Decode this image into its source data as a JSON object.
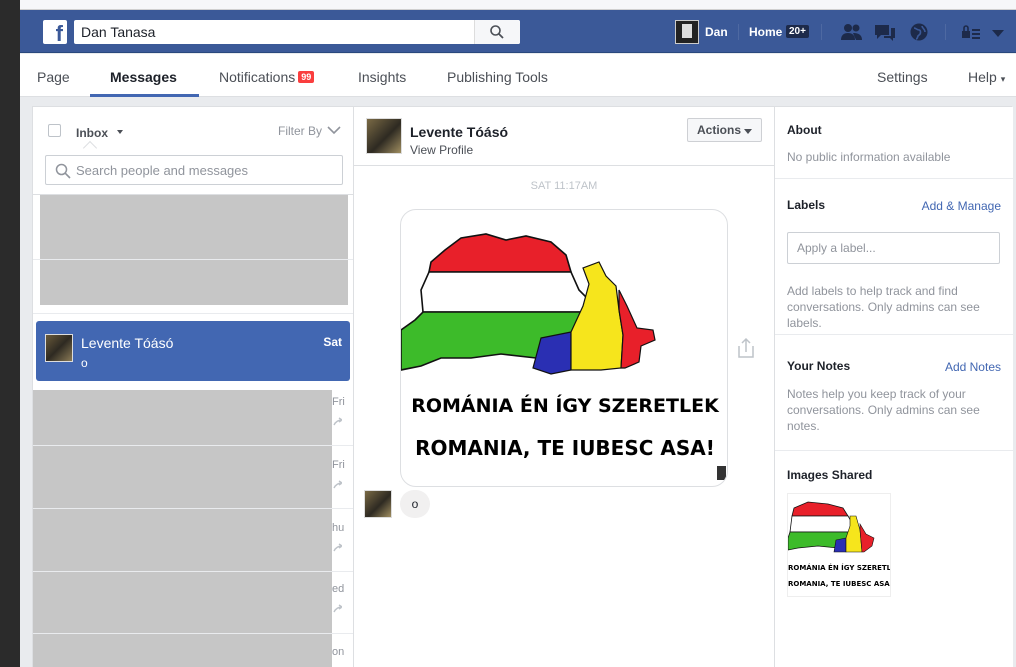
{
  "topbar": {
    "logo": "f",
    "search_value": "Dan Tanasa",
    "user_name": "Dan",
    "home_label": "Home",
    "home_count": "20+"
  },
  "page_nav": {
    "tabs": [
      {
        "label": "Page"
      },
      {
        "label": "Messages"
      },
      {
        "label": "Notifications",
        "badge": "99"
      },
      {
        "label": "Insights"
      },
      {
        "label": "Publishing Tools"
      }
    ],
    "settings_label": "Settings",
    "help_label": "Help",
    "help_caret": "▾"
  },
  "inbox": {
    "folder_label": "Inbox",
    "filter_label": "Filter By",
    "search_placeholder": "Search people and messages",
    "active_conversation": {
      "name": "Levente Tóásó",
      "time": "Sat",
      "snippet": "o"
    },
    "peek_times": [
      "Fri",
      "Fri",
      "hu",
      "ed",
      "on"
    ]
  },
  "conversation": {
    "name": "Levente Tóásó",
    "view_profile": "View Profile",
    "actions_label": "Actions",
    "timestamp": "SAT 11:17AM",
    "image_caption_1": "ROMÁNIA ÉN ÍGY SZERETLEK",
    "image_caption_2": "ROMANIA, TE IUBESC ASA!",
    "message_text": "o"
  },
  "sidebar": {
    "about_title": "About",
    "about_text": "No public information available",
    "labels_title": "Labels",
    "labels_link": "Add & Manage",
    "labels_placeholder": "Apply a label...",
    "labels_help": "Add labels to help track and find conversations. Only admins can see labels.",
    "notes_title": "Your Notes",
    "notes_link": "Add Notes",
    "notes_help": "Notes help you keep track of your conversations. Only admins can see notes.",
    "images_title": "Images Shared",
    "thumb_caption_1": "ROMÁNIA ÉN ÍGY SZERETLEK",
    "thumb_caption_2": "ROMANIA, TE IUBESC ASA"
  },
  "colors": {
    "facebook_blue": "#3b5998",
    "active_row": "#4267b2",
    "link": "#4267b2",
    "badge_red": "#fa3e3e"
  }
}
